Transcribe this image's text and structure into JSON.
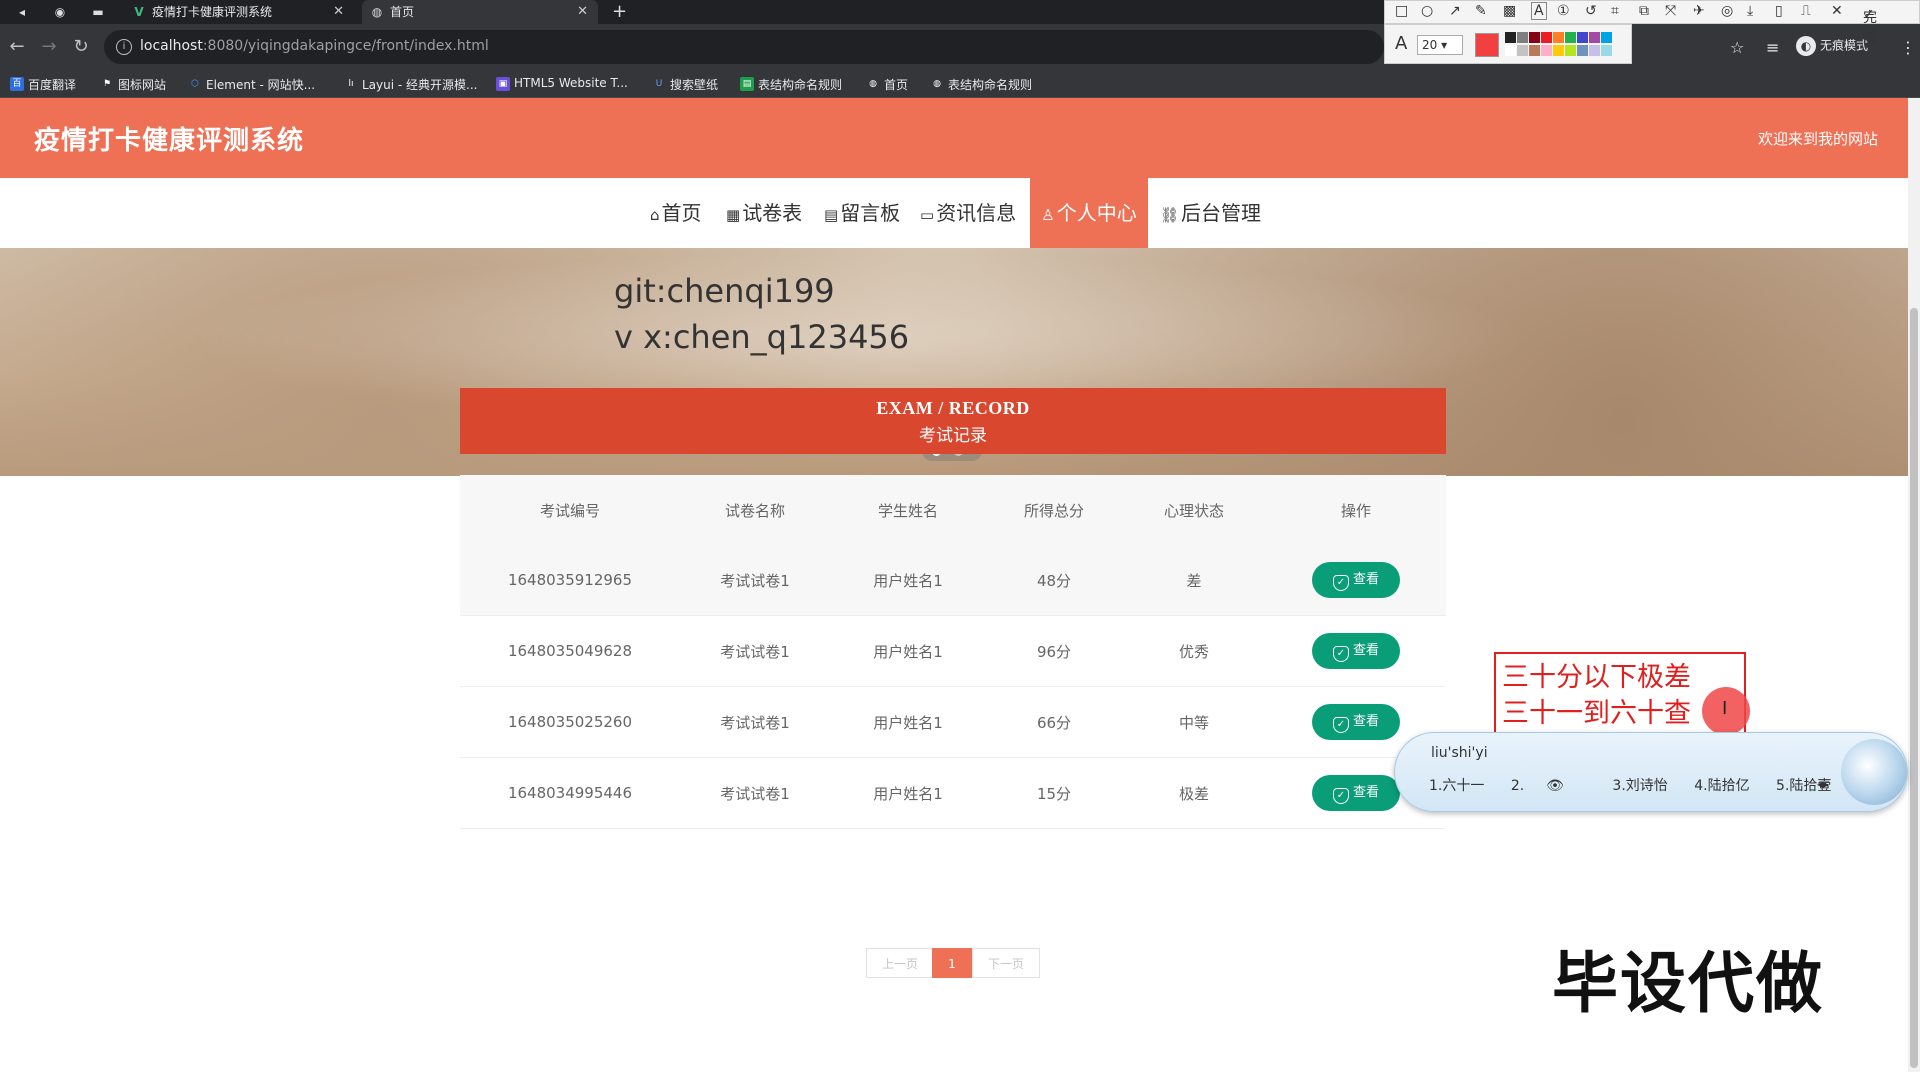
{
  "browser": {
    "tabs": [
      {
        "title": "疫情打卡健康评测系统",
        "favicon": "V",
        "active": false
      },
      {
        "title": "首页",
        "favicon": "globe-icon",
        "active": true
      }
    ],
    "new_tab": "+",
    "url_host": "localhost",
    "url_rest": ":8080/yiqingdakapingce/front/index.html",
    "bookmarks": [
      "百度翻译",
      "图标网站",
      "Element - 网站快...",
      "Layui - 经典开源模...",
      "HTML5 Website T...",
      "搜索壁纸",
      "表结构命名规则",
      "首页",
      "表结构命名规则"
    ],
    "profile_label": "无痕模式"
  },
  "snip_toolbar": {
    "done_label": "完成",
    "font_size": "20",
    "current_color": "#f24040",
    "swatches": [
      "#222222",
      "#7f7f7f",
      "#880015",
      "#ed1c24",
      "#ff7f27",
      "#22b14c",
      "#3f48cc",
      "#a349a4",
      "#00a2e8",
      "#ffffff",
      "#c3c3c3",
      "#b97a57",
      "#ffaec9",
      "#ffc90e",
      "#b5e61d",
      "#7092be",
      "#c8bfe7",
      "#99d9ea"
    ]
  },
  "site": {
    "title": "疫情打卡健康评测系统",
    "welcome": "欢迎来到我的网站",
    "accent": "#ee7156",
    "nav": [
      {
        "icon": "⌂",
        "label": "首页",
        "active": false
      },
      {
        "icon": "▦",
        "label": "试卷表",
        "active": false
      },
      {
        "icon": "▤",
        "label": "留言板",
        "active": false
      },
      {
        "icon": "▭",
        "label": "资讯信息",
        "active": false
      },
      {
        "icon": "♙",
        "label": "个人中心",
        "active": true
      },
      {
        "icon": "⛓",
        "label": "后台管理",
        "active": false
      }
    ]
  },
  "banner": {
    "line1": "git:chenqi199",
    "line2": "v x:chen_q123456",
    "slide_count": 2,
    "active_slide": 1
  },
  "section": {
    "title_en": "EXAM / RECORD",
    "title_zh": "考试记录",
    "header_color": "#d9472f"
  },
  "table": {
    "columns": [
      "考试编号",
      "试卷名称",
      "学生姓名",
      "所得总分",
      "心理状态",
      "操作"
    ],
    "rows": [
      {
        "id": "1648035912965",
        "paper": "考试试卷1",
        "student": "用户姓名1",
        "score": "48分",
        "state": "差",
        "action": "查看"
      },
      {
        "id": "1648035049628",
        "paper": "考试试卷1",
        "student": "用户姓名1",
        "score": "96分",
        "state": "优秀",
        "action": "查看"
      },
      {
        "id": "1648035025260",
        "paper": "考试试卷1",
        "student": "用户姓名1",
        "score": "66分",
        "state": "中等",
        "action": "查看"
      },
      {
        "id": "1648034995446",
        "paper": "考试试卷1",
        "student": "用户姓名1",
        "score": "15分",
        "state": "极差",
        "action": "查看"
      }
    ],
    "button_color": "#099d78"
  },
  "pagination": {
    "prev": "上一页",
    "current": "1",
    "next": "下一页"
  },
  "annotation": {
    "line1": "三十分以下极差",
    "line2": "三十一到六十查"
  },
  "ime": {
    "composition": "liu'shi'yi",
    "candidates": [
      "1.六十一",
      "2.",
      "3.刘诗怡",
      "4.陆拾亿",
      "5.陆拾壹"
    ]
  },
  "watermark": "毕设代做"
}
